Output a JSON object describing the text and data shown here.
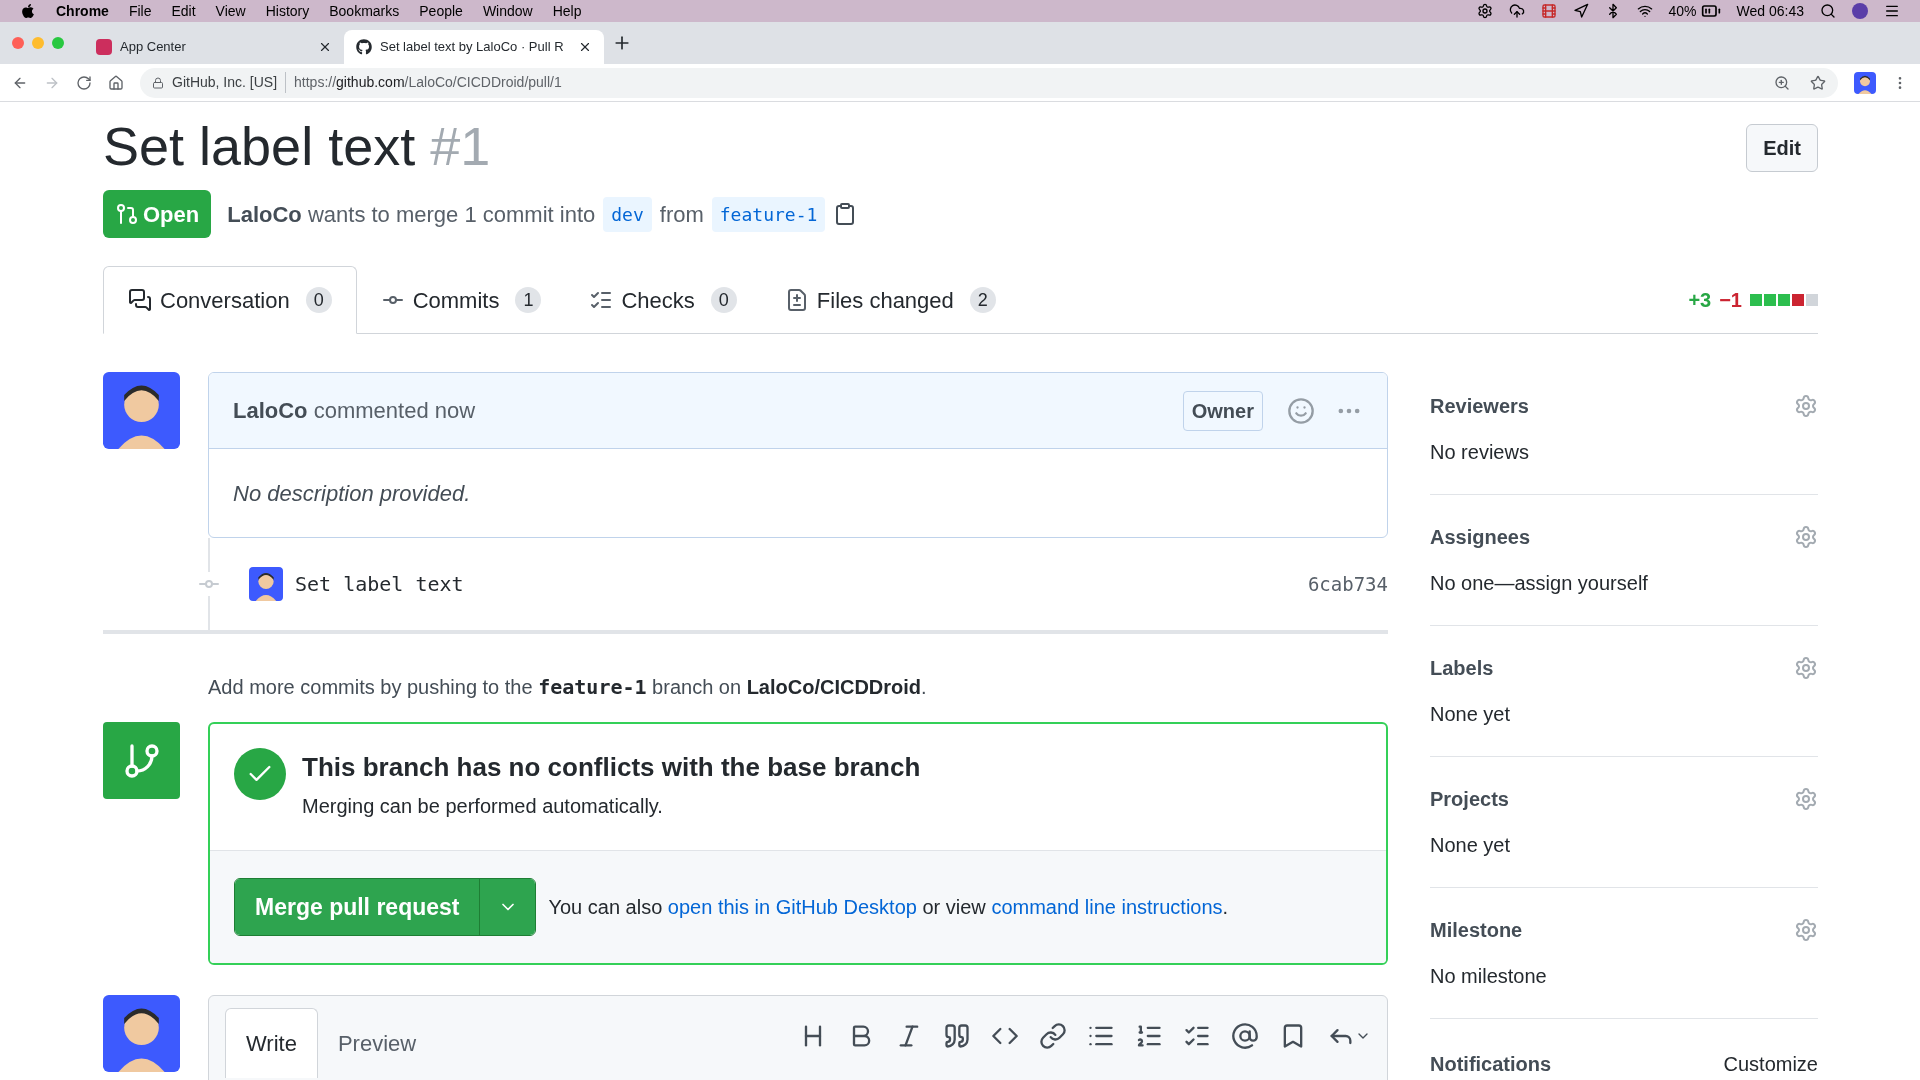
{
  "menubar": {
    "app": "Chrome",
    "items": [
      "File",
      "Edit",
      "View",
      "History",
      "Bookmarks",
      "People",
      "Window",
      "Help"
    ],
    "battery": "40%",
    "clock": "Wed 06:43"
  },
  "browser_tabs": [
    {
      "title": "App Center",
      "selected": false
    },
    {
      "title": "Set label text by LaloCo · Pull R",
      "selected": true
    }
  ],
  "address_bar": {
    "site": "GitHub, Inc. [US]",
    "scheme": "https://",
    "host": "github.com",
    "path": "/LaloCo/CICDDroid/pull/1"
  },
  "pr": {
    "title": "Set label text",
    "number": "#1",
    "state": "Open",
    "author": "LaloCo",
    "summary": "wants to merge 1 commit into",
    "base": "dev",
    "from": "from",
    "head": "feature-1"
  },
  "edit_button": "Edit",
  "pr_tabs": [
    {
      "label": "Conversation",
      "count": "0",
      "selected": true
    },
    {
      "label": "Commits",
      "count": "1",
      "selected": false
    },
    {
      "label": "Checks",
      "count": "0",
      "selected": false
    },
    {
      "label": "Files changed",
      "count": "2",
      "selected": false
    }
  ],
  "diffstat": {
    "additions": "+3",
    "deletions": "−1",
    "blocks": [
      {
        "color": "#2cbe4e"
      },
      {
        "color": "#2cbe4e"
      },
      {
        "color": "#2cbe4e"
      },
      {
        "color": "#cb2431"
      },
      {
        "color": "#d1d5da"
      }
    ]
  },
  "comment": {
    "author": "LaloCo",
    "action": "commented now",
    "badge": "Owner",
    "body": "No description provided."
  },
  "commit": {
    "message": "Set label text",
    "sha": "6cab734"
  },
  "push_hint": {
    "before": "Add more commits by pushing to the",
    "branch": "feature-1",
    "middle": "branch on",
    "repo": "LaloCo/CICDDroid",
    "after": "."
  },
  "merge": {
    "title": "This branch has no conflicts with the base branch",
    "subtitle": "Merging can be performed automatically.",
    "button": "Merge pull request",
    "note_before": "You can also",
    "link_desktop": "open this in GitHub Desktop",
    "note_middle": "or view",
    "link_cli": "command line instructions",
    "note_after": "."
  },
  "composer": {
    "tabs": [
      {
        "label": "Write",
        "selected": true
      },
      {
        "label": "Preview",
        "selected": false
      }
    ]
  },
  "sidebar": {
    "sections": [
      {
        "title": "Reviewers",
        "value": "No reviews"
      },
      {
        "title": "Assignees",
        "value": "No one—assign yourself"
      },
      {
        "title": "Labels",
        "value": "None yet"
      },
      {
        "title": "Projects",
        "value": "None yet"
      },
      {
        "title": "Milestone",
        "value": "No milestone"
      }
    ],
    "notifications": {
      "title": "Notifications",
      "action": "Customize"
    }
  }
}
